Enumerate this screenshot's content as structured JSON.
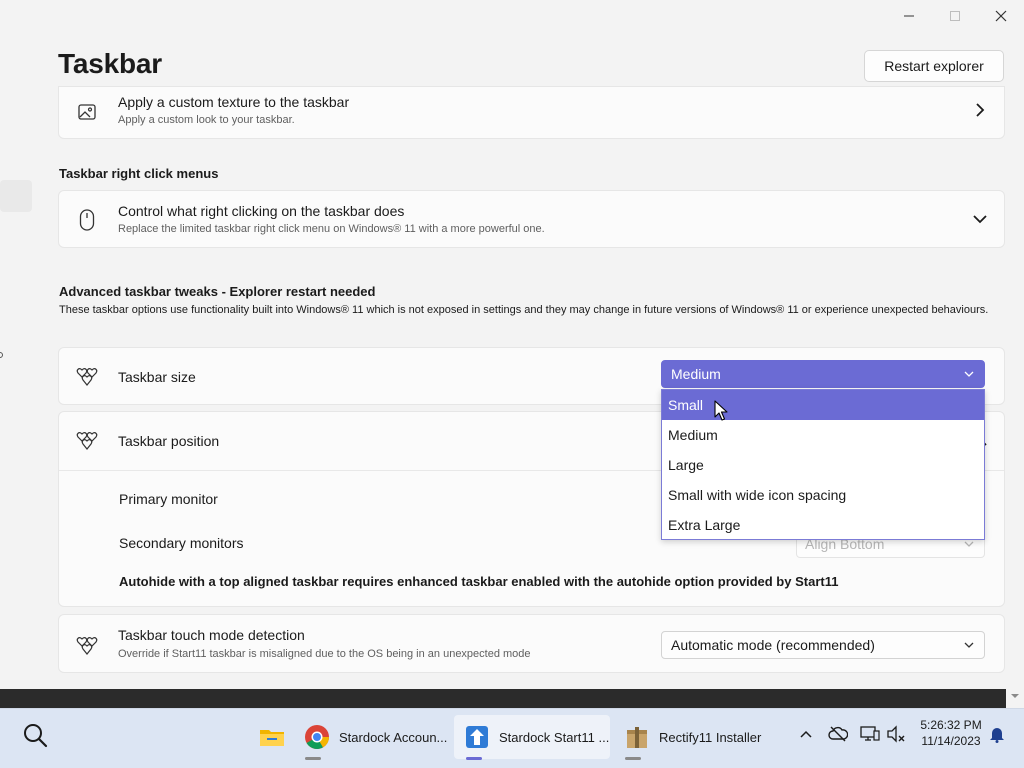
{
  "window": {
    "controls": {
      "minimize": "minimize-icon",
      "maximize": "maximize-icon",
      "close": "close-icon"
    }
  },
  "page": {
    "title": "Taskbar",
    "restart_button": "Restart explorer"
  },
  "texture_card": {
    "icon": "image-icon",
    "title": "Apply a custom texture to the taskbar",
    "subtitle": "Apply a custom look to your taskbar."
  },
  "right_click_section": {
    "heading": "Taskbar right click menus",
    "card": {
      "icon": "mouse-icon",
      "title": "Control what right clicking on the taskbar does",
      "subtitle": "Replace the limited taskbar right click menu on Windows® 11 with a more powerful one."
    }
  },
  "advanced_section": {
    "heading": "Advanced taskbar tweaks - Explorer restart needed",
    "description": "These taskbar options use functionality built into Windows® 11 which is not exposed in settings and they may change in future versions of Windows® 11 or experience unexpected behaviours.",
    "taskbar_size": {
      "icon": "hearts-icon",
      "label": "Taskbar size",
      "selected": "Medium",
      "options": [
        "Small",
        "Medium",
        "Large",
        "Small with wide icon spacing",
        "Extra Large"
      ],
      "highlighted": "Small"
    },
    "taskbar_position": {
      "icon": "hearts-icon",
      "label": "Taskbar position",
      "primary_label": "Primary monitor",
      "secondary_label": "Secondary monitors",
      "secondary_value": "Align Bottom",
      "warning": "Autohide with a top aligned taskbar requires enhanced taskbar enabled with the autohide option provided by Start11"
    },
    "touch_mode": {
      "icon": "hearts-icon",
      "label": "Taskbar touch mode detection",
      "subtitle": "Override if Start11 taskbar is misaligned due to the OS being in an unexpected mode",
      "selected": "Automatic mode (recommended)"
    }
  },
  "taskbar": {
    "search_icon": "search-icon",
    "apps": [
      {
        "icon": "file-explorer-icon",
        "label": ""
      },
      {
        "icon": "chrome-icon",
        "label": "Stardock Accoun..."
      },
      {
        "icon": "start11-icon",
        "label": "Stardock Start11 ..."
      },
      {
        "icon": "installer-box-icon",
        "label": "Rectify11 Installer"
      }
    ],
    "tray": [
      "chevron-up-icon",
      "onedrive-offline-icon",
      "monitor-icon",
      "volume-muted-icon"
    ],
    "time": "5:26:32 PM",
    "date": "11/14/2023",
    "notification_icon": "bell-icon",
    "colors": {
      "accent": "#6b6bd4",
      "taskbar_bg": "#dce5f3"
    }
  }
}
